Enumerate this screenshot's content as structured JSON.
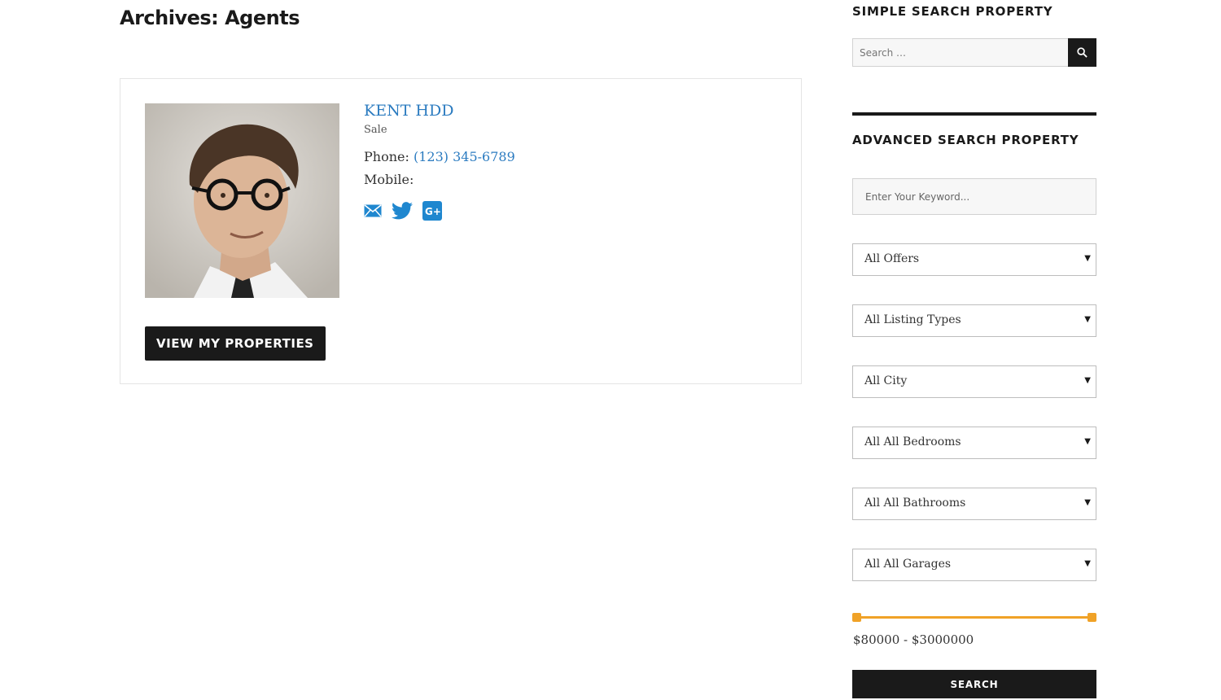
{
  "page": {
    "title": "Archives: Agents"
  },
  "agent": {
    "name": "KENT HDD",
    "role": "Sale",
    "phone_label": "Phone:",
    "phone": "(123) 345-6789",
    "mobile_label": "Mobile:",
    "mobile": "",
    "social_icons": [
      "email-icon",
      "twitter-icon",
      "google-plus-icon"
    ],
    "view_button": "VIEW MY PROPERTIES"
  },
  "simple_search": {
    "title": "SIMPLE SEARCH PROPERTY",
    "placeholder": "Search …",
    "icon": "search-icon"
  },
  "advanced_search": {
    "title": "ADVANCED SEARCH PROPERTY",
    "keyword_placeholder": "Enter Your Keyword...",
    "selects": [
      "All Offers",
      "All Listing Types",
      "All City",
      "All All Bedrooms",
      "All All Bathrooms",
      "All All Garages"
    ],
    "price_min": 80000,
    "price_max": 3000000,
    "price_range_label": "$80000 - $3000000",
    "search_button": "SEARCH"
  },
  "colors": {
    "link": "#2b7bc0",
    "accent": "#f0a227",
    "dark": "#1a1a1a"
  }
}
